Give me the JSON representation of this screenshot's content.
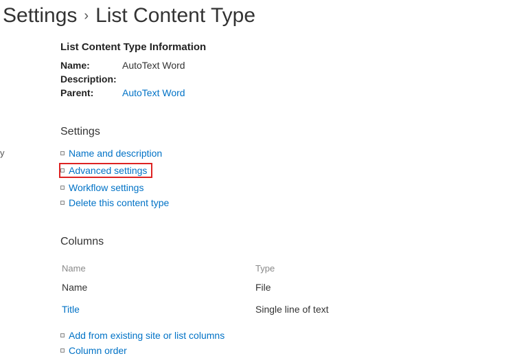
{
  "breadcrumb": {
    "parent": "Settings",
    "current": "List Content Type"
  },
  "info": {
    "heading": "List Content Type Information",
    "name_label": "Name:",
    "name_value": "AutoText Word",
    "description_label": "Description:",
    "description_value": "",
    "parent_label": "Parent:",
    "parent_value": "AutoText Word"
  },
  "settings": {
    "heading": "Settings",
    "links": [
      "Name and description",
      "Advanced settings",
      "Workflow settings",
      "Delete this content type"
    ]
  },
  "columns": {
    "heading": "Columns",
    "header_name": "Name",
    "header_type": "Type",
    "rows": [
      {
        "name": "Name",
        "name_is_link": false,
        "type": "File"
      },
      {
        "name": "Title",
        "name_is_link": true,
        "type": "Single line of text"
      }
    ],
    "links": [
      "Add from existing site or list columns",
      "Column order"
    ]
  },
  "partial_left": "y"
}
